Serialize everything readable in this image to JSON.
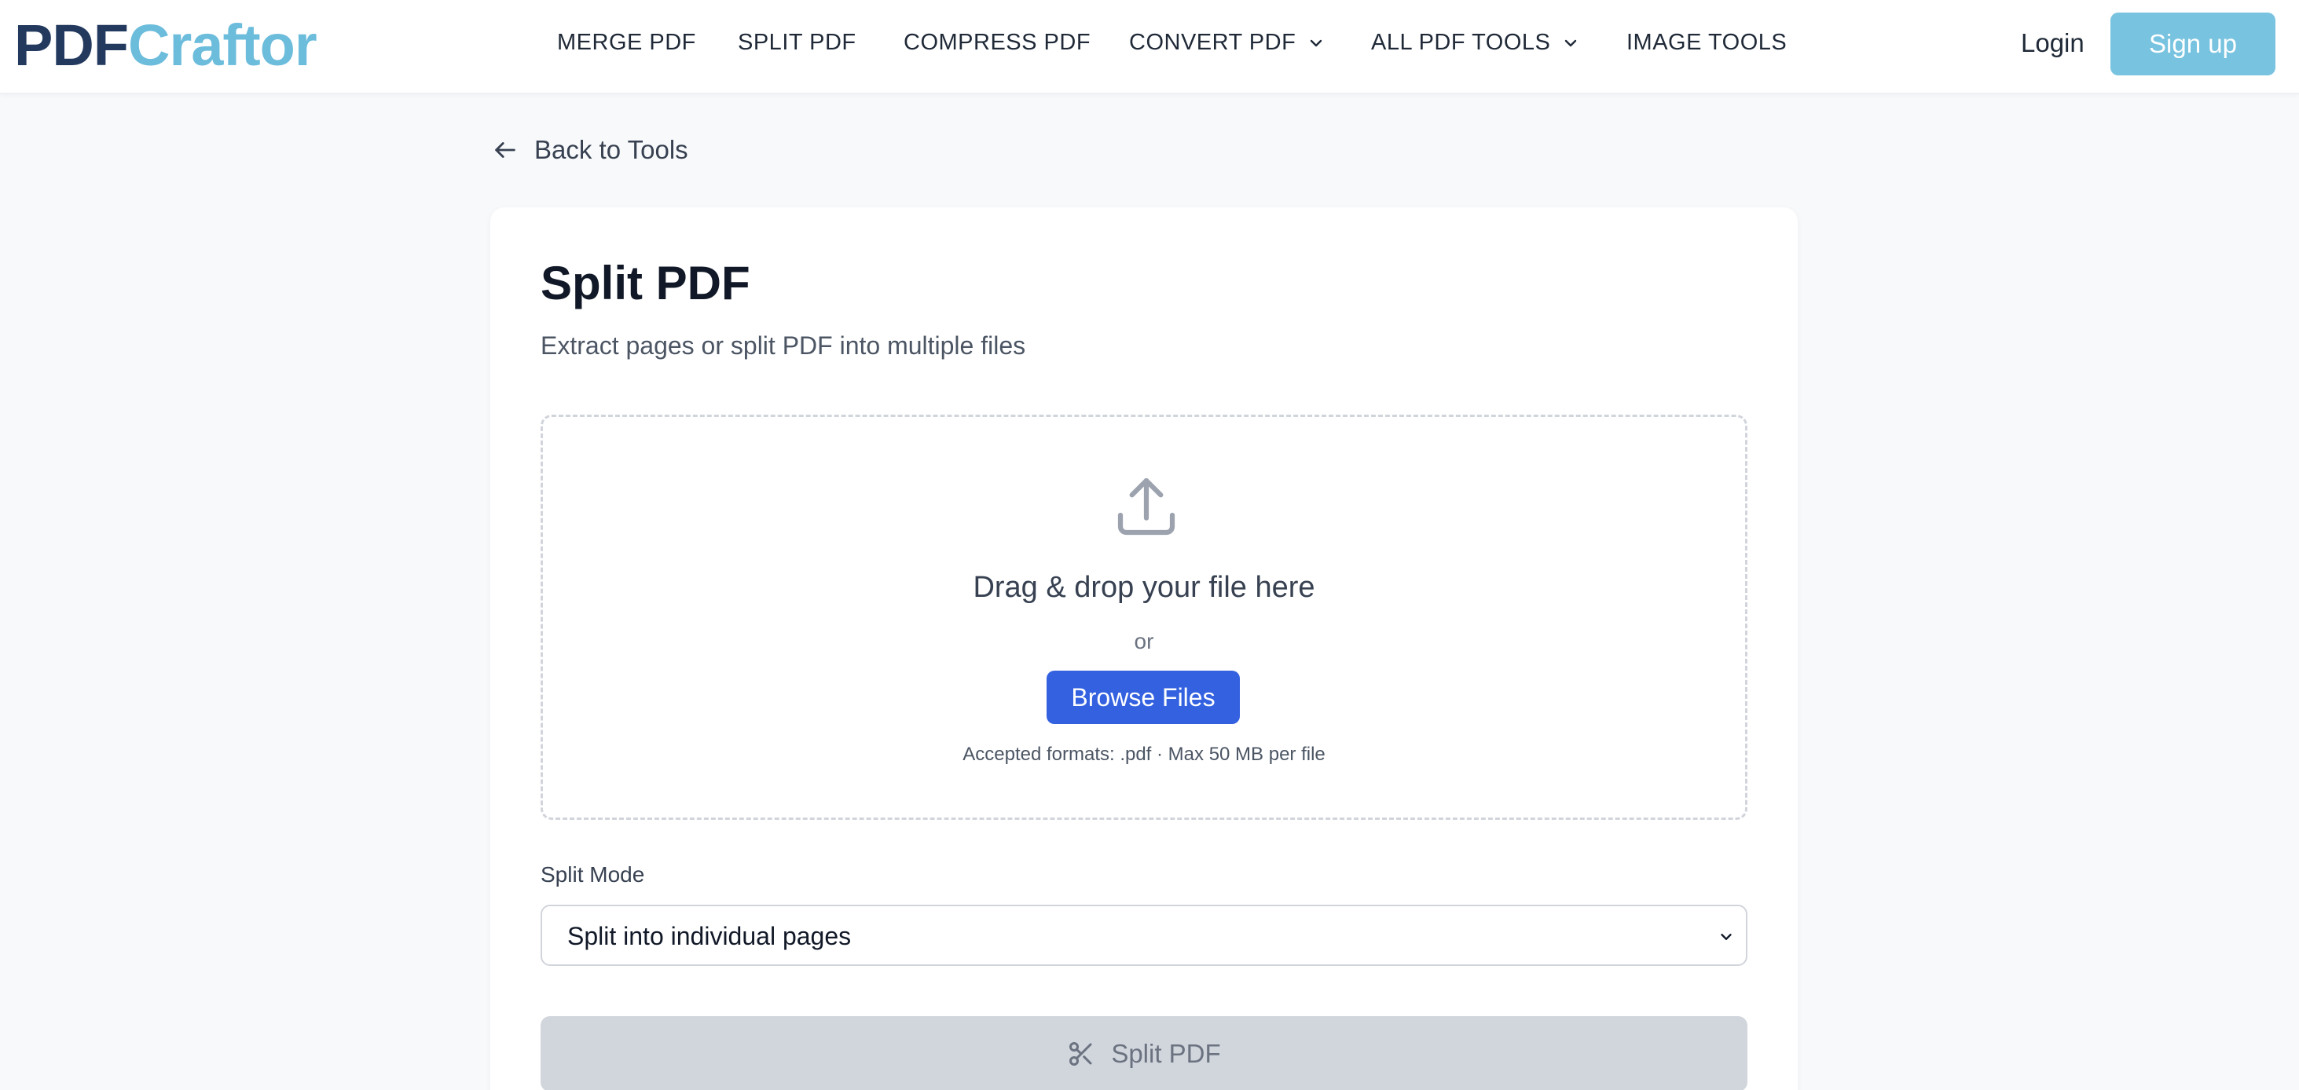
{
  "header": {
    "logo_part1": "PDF",
    "logo_part2": "Craftor",
    "nav": [
      {
        "label": "MERGE PDF",
        "dropdown": false
      },
      {
        "label": "SPLIT PDF",
        "dropdown": false
      },
      {
        "label": "COMPRESS PDF",
        "dropdown": false
      },
      {
        "label": "CONVERT PDF",
        "dropdown": true
      },
      {
        "label": "ALL PDF TOOLS",
        "dropdown": true
      },
      {
        "label": "IMAGE TOOLS",
        "dropdown": false
      }
    ],
    "login_label": "Login",
    "signup_label": "Sign up"
  },
  "back_link": {
    "label": "Back to Tools",
    "icon": "arrow-left-icon"
  },
  "tool": {
    "title": "Split PDF",
    "subtitle": "Extract pages or split PDF into multiple files"
  },
  "dropzone": {
    "icon": "upload-icon",
    "title": "Drag & drop your file here",
    "or": "or",
    "browse_label": "Browse Files",
    "accepted": "Accepted formats: .pdf · Max 50 MB per file"
  },
  "split_mode": {
    "label": "Split Mode",
    "selected": "Split into individual pages"
  },
  "action": {
    "label": "Split PDF",
    "icon": "scissors-icon"
  },
  "colors": {
    "brand_dark": "#233a5e",
    "brand_light": "#6cbcdc",
    "primary_button": "#3361e0",
    "signup_button": "#78c3e0",
    "disabled_button": "#d1d5dc"
  }
}
